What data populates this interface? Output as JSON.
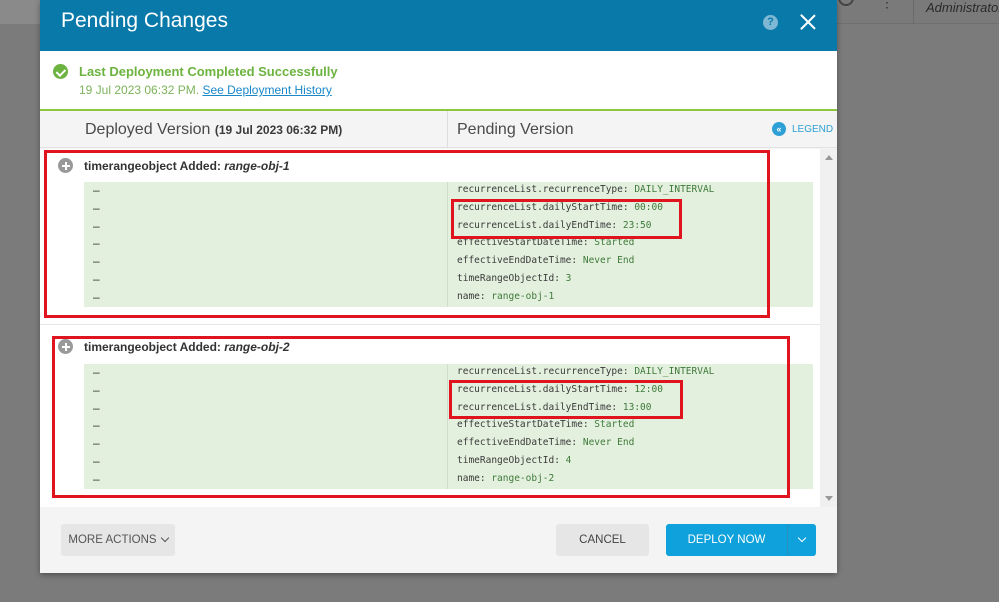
{
  "background": {
    "user_label": "Administrator"
  },
  "modal": {
    "title": "Pending Changes",
    "help_icon_glyph": "?",
    "status": {
      "title": "Last Deployment Completed Successfully",
      "timestamp": "19 Jul 2023 06:32 PM.",
      "history_link": "See Deployment History"
    },
    "columns": {
      "deployed_label": "Deployed Version",
      "deployed_timestamp": "(19 Jul 2023 06:32 PM)",
      "pending_label": "Pending Version",
      "legend_label": "LEGEND",
      "legend_icon_glyph": "«"
    },
    "changes": [
      {
        "prefix": "timerangeobject Added: ",
        "name": "range-obj-1",
        "rows": [
          {
            "deployed": "–",
            "key": "recurrenceList.recurrenceType: ",
            "value": "DAILY_INTERVAL"
          },
          {
            "deployed": "–",
            "key": "recurrenceList.dailyStartTime: ",
            "value": "00:00"
          },
          {
            "deployed": "–",
            "key": "recurrenceList.dailyEndTime: ",
            "value": "23:50"
          },
          {
            "deployed": "–",
            "key": "effectiveStartDateTime: ",
            "value": "Started"
          },
          {
            "deployed": "–",
            "key": "effectiveEndDateTime: ",
            "value": "Never End"
          },
          {
            "deployed": "–",
            "key": "timeRangeObjectId: ",
            "value": "3"
          },
          {
            "deployed": "–",
            "key": "name: ",
            "value": "range-obj-1"
          }
        ]
      },
      {
        "prefix": "timerangeobject Added: ",
        "name": "range-obj-2",
        "rows": [
          {
            "deployed": "–",
            "key": "recurrenceList.recurrenceType: ",
            "value": "DAILY_INTERVAL"
          },
          {
            "deployed": "–",
            "key": "recurrenceList.dailyStartTime: ",
            "value": "12:00"
          },
          {
            "deployed": "–",
            "key": "recurrenceList.dailyEndTime: ",
            "value": "13:00"
          },
          {
            "deployed": "–",
            "key": "effectiveStartDateTime: ",
            "value": "Started"
          },
          {
            "deployed": "–",
            "key": "effectiveEndDateTime: ",
            "value": "Never End"
          },
          {
            "deployed": "–",
            "key": "timeRangeObjectId: ",
            "value": "4"
          },
          {
            "deployed": "–",
            "key": "name: ",
            "value": "range-obj-2"
          }
        ]
      }
    ],
    "footer": {
      "more_actions": "MORE ACTIONS",
      "cancel": "CANCEL",
      "deploy_now": "DEPLOY NOW"
    }
  },
  "colors": {
    "header": "#0879a9",
    "success": "#6cb33f",
    "primary_button": "#0ea1db",
    "highlight_box": "#e0141e",
    "added_row_bg": "#e3f0de"
  }
}
